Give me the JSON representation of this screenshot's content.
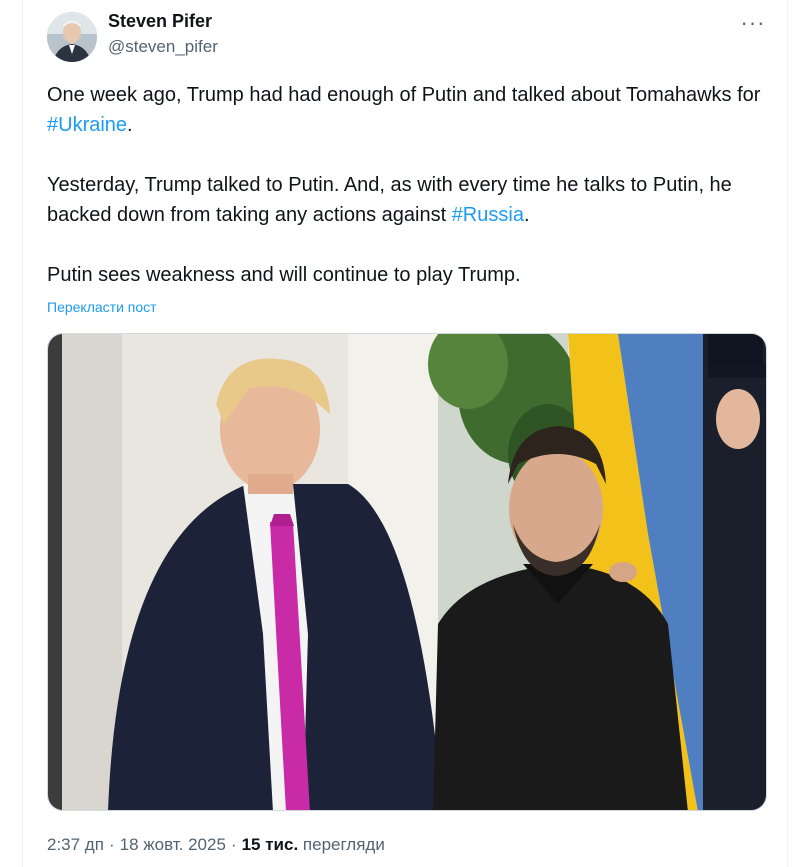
{
  "author": {
    "name": "Steven Pifer",
    "handle": "@steven_pifer"
  },
  "menu": {
    "more_icon": "more-horizontal-icon",
    "more_glyph": "···"
  },
  "tweet": {
    "p1_before": "One week ago, Trump had had enough of Putin and talked about Tomahawks for ",
    "p1_hashtag": "#Ukraine",
    "p1_after": ".",
    "p2_before": "Yesterday, Trump talked to Putin. And, as with every time he talks to Putin, he backed down from taking any actions against ",
    "p2_hashtag": "#Russia",
    "p2_after": ".",
    "p3": "Putin sees weakness and will continue to play Trump.",
    "translate_label": "Перекласти пост"
  },
  "footer": {
    "time": "2:37 дп",
    "separator": "·",
    "date": "18 жовт. 2025",
    "views_count": "15 тис.",
    "views_label": "перегляди"
  },
  "colors": {
    "link": "#1d9bf0",
    "text": "#0f1419",
    "secondary": "#536471",
    "flag_yellow": "#f2c21b",
    "flag_blue": "#4f7fc0"
  }
}
